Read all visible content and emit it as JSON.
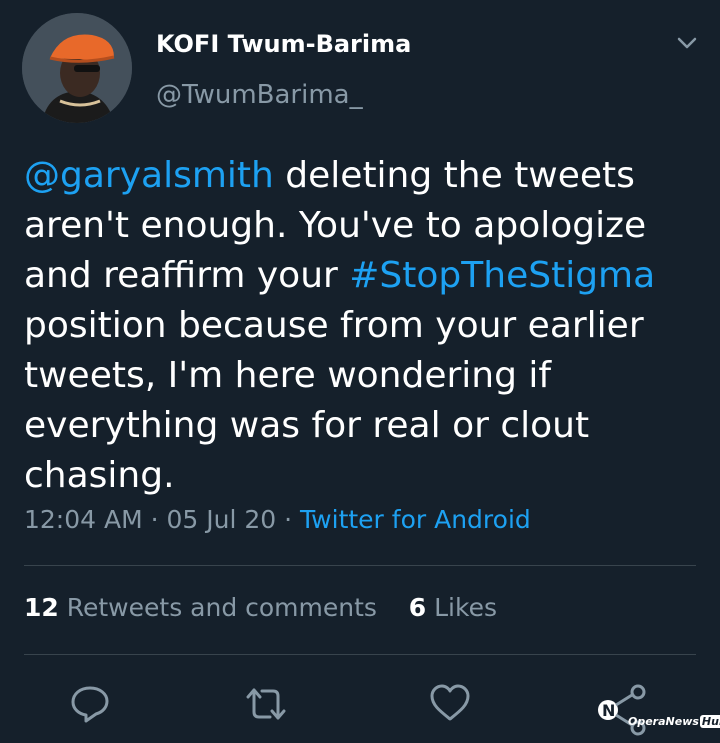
{
  "author": {
    "name": "KOFI Twum-Barima",
    "handle": "@TwumBarima_"
  },
  "tweet": {
    "lines": [
      [
        {
          "text": "@garyalsmith",
          "link": true
        },
        {
          "text": " deleting the tweets",
          "link": false
        }
      ],
      [
        {
          "text": "aren't enough. You've to apologize",
          "link": false
        }
      ],
      [
        {
          "text": "and reaffirm your ",
          "link": false
        },
        {
          "text": "#StopTheStigma",
          "link": true
        }
      ],
      [
        {
          "text": "position because from your earlier",
          "link": false
        }
      ],
      [
        {
          "text": "tweets, I'm here wondering if",
          "link": false
        }
      ],
      [
        {
          "text": "everything was for real or clout",
          "link": false
        }
      ],
      [
        {
          "text": "chasing.",
          "link": false
        }
      ]
    ]
  },
  "meta": {
    "time": "12:04 AM",
    "date": "05 Jul 20",
    "separator": " · ",
    "source": "Twitter for Android"
  },
  "stats": {
    "retweets_count": "12",
    "retweets_label": "Retweets and comments",
    "likes_count": "6",
    "likes_label": "Likes"
  },
  "actions": {
    "reply_icon": "reply-icon",
    "retweet_icon": "retweet-icon",
    "like_icon": "heart-icon",
    "share_icon": "share-icon"
  },
  "watermark": {
    "brand": "OperaNews",
    "badge": "Hub"
  },
  "colors": {
    "background": "#15202b",
    "link": "#1da1f2",
    "secondary_text": "#8899a6",
    "divider": "#38444d",
    "avatar_hat": "#e8692a"
  }
}
